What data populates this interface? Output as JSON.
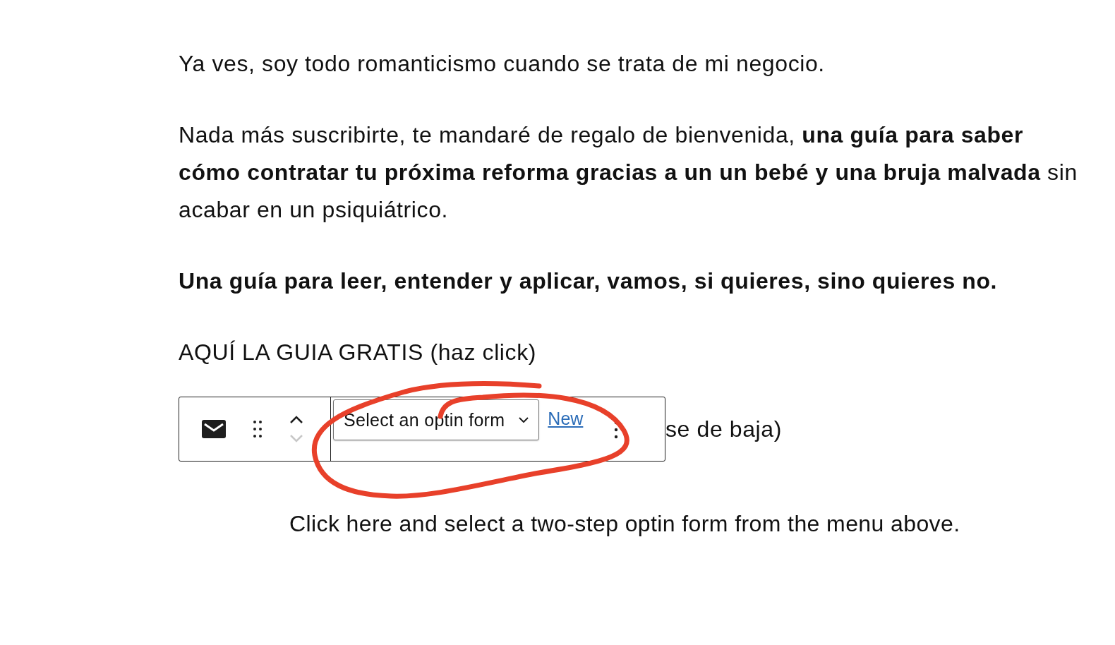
{
  "paragraphs": [
    {
      "text": "Ya ves, soy todo romanticismo cuando se trata de mi negocio.",
      "bold": false
    },
    {
      "text": "Nada más suscribirte, te mandaré de regalo de bienvenida, **una guía para saber cómo contratar tu próxima reforma gracias a un un bebé y una bruja malvada** sin acabar en un psiquiátrico.",
      "bold": false
    },
    {
      "text": "Una guía para leer, entender y aplicar, vamos, si quieres, sino quieres no.",
      "bold": true
    },
    {
      "text": "AQUÍ LA GUIA GRATIS (haz click)",
      "bold": false
    }
  ],
  "toolbar": {
    "move_up": {
      "disabled": false
    },
    "move_down": {
      "disabled": true
    },
    "select": {
      "placeholder": "Select an optin form"
    },
    "new_link": "New"
  },
  "covered_text": "se de baja)",
  "block_hint": "Click here and select a two-step optin form from the menu above."
}
